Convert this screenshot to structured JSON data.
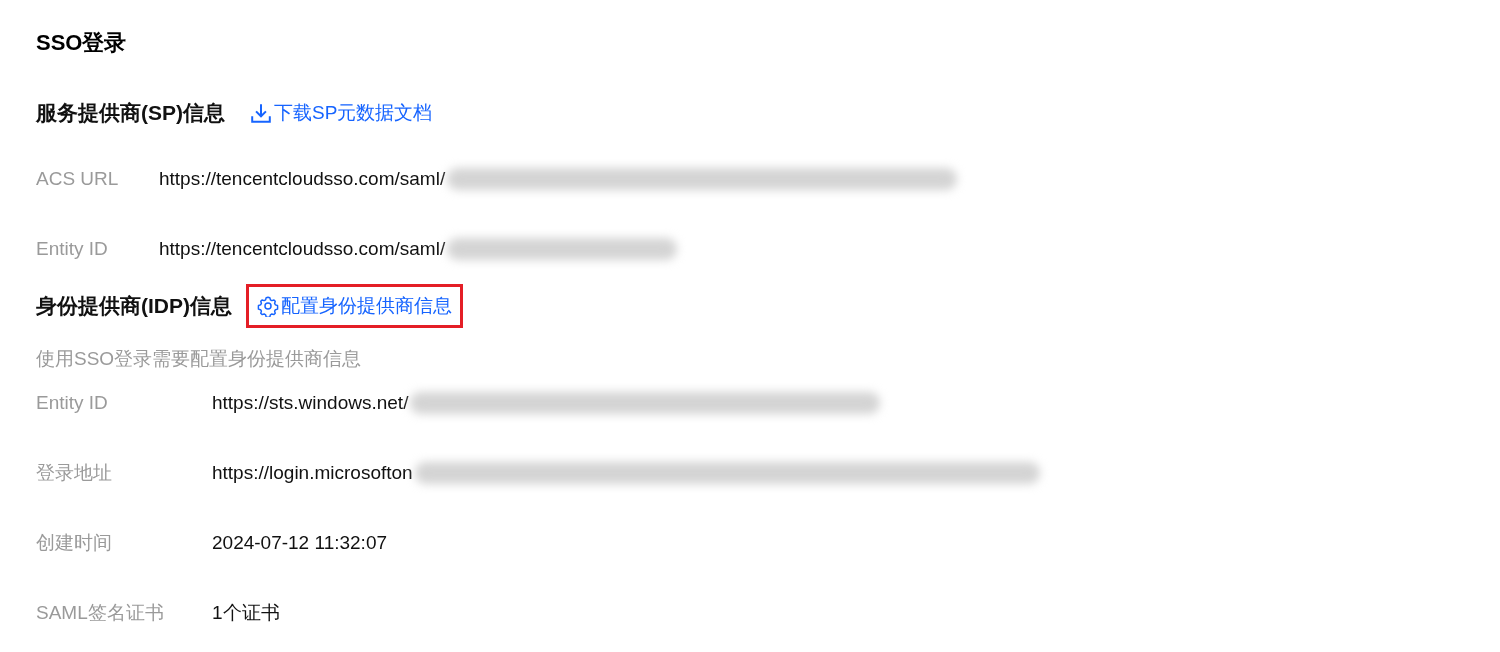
{
  "title": "SSO登录",
  "sp": {
    "heading": "服务提供商(SP)信息",
    "link": "下载SP元数据文档",
    "rows": [
      {
        "label": "ACS URL",
        "value": "https://tencentcloudsso.com/saml/",
        "redacted": true
      },
      {
        "label": "Entity ID",
        "value": "https://tencentcloudsso.com/saml/",
        "redacted": true
      }
    ]
  },
  "idp": {
    "heading": "身份提供商(IDP)信息",
    "link": "配置身份提供商信息",
    "highlighted": true,
    "hint": "使用SSO登录需要配置身份提供商信息",
    "rows": [
      {
        "label": "Entity ID",
        "value": "https://sts.windows.net/",
        "redacted": true
      },
      {
        "label": "登录地址",
        "value": "https://login.microsofton",
        "redacted": true
      },
      {
        "label": "创建时间",
        "value": "2024-07-12 11:32:07",
        "redacted": false
      },
      {
        "label": "SAML签名证书",
        "value": "1个证书",
        "redacted": false
      }
    ]
  }
}
